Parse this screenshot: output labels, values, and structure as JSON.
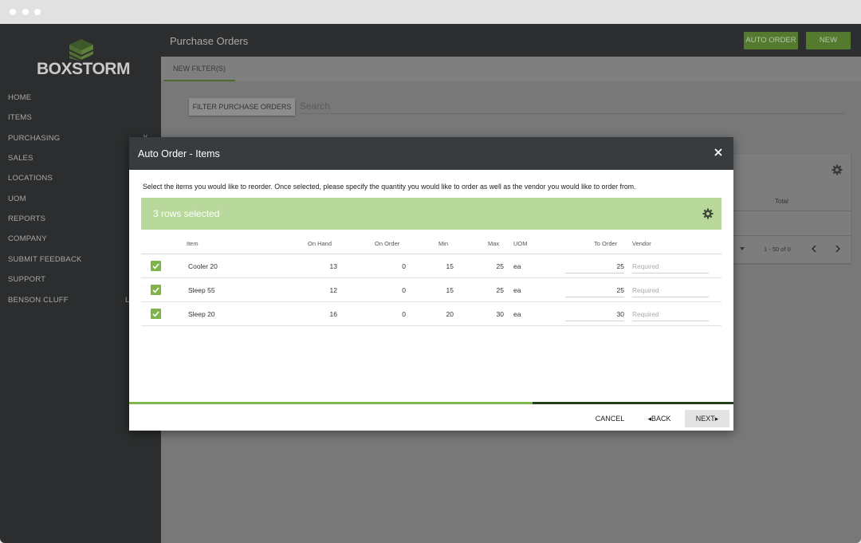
{
  "sidebar": {
    "brand": "BOXSTORM",
    "items": [
      {
        "label": "HOME"
      },
      {
        "label": "ITEMS"
      },
      {
        "label": "PURCHASING"
      },
      {
        "label": "SALES"
      },
      {
        "label": "LOCATIONS"
      },
      {
        "label": "UOM"
      },
      {
        "label": "REPORTS"
      },
      {
        "label": "COMPANY"
      },
      {
        "label": "SUBMIT FEEDBACK"
      },
      {
        "label": "SUPPORT"
      },
      {
        "label": "BENSON CLUFF"
      }
    ],
    "purchasing_marker": "v",
    "user_marker": "L"
  },
  "header": {
    "title": "Purchase Orders",
    "auto_order_label": "AUTO ORDER",
    "new_label": "NEW"
  },
  "tabs": {
    "active": "NEW FILTER(S)"
  },
  "filter": {
    "button_label": "FILTER PURCHASE ORDERS",
    "search_placeholder": "Search"
  },
  "background_card": {
    "total_header": "Total",
    "paging": "1 - 50 of 0"
  },
  "modal": {
    "title": "Auto Order - Items",
    "instructions": "Select the items you would like to reorder. Once selected, please specify the quantity you would like to order as well as the vendor you would like to order from.",
    "selection_text": "3 rows selected",
    "columns": {
      "item": "Item",
      "on_hand": "On Hand",
      "on_order": "On Order",
      "min": "Min",
      "max": "Max",
      "uom": "UOM",
      "to_order": "To Order",
      "vendor": "Vendor"
    },
    "rows": [
      {
        "item": "Cooler 20",
        "on_hand": "13",
        "on_order": "0",
        "min": "15",
        "max": "25",
        "uom": "ea",
        "to_order": "25",
        "vendor_placeholder": "Required",
        "checked": true
      },
      {
        "item": "Sleep 55",
        "on_hand": "12",
        "on_order": "0",
        "min": "15",
        "max": "25",
        "uom": "ea",
        "to_order": "25",
        "vendor_placeholder": "Required",
        "checked": true
      },
      {
        "item": "Sleep 20",
        "on_hand": "16",
        "on_order": "0",
        "min": "20",
        "max": "30",
        "uom": "ea",
        "to_order": "30",
        "vendor_placeholder": "Required",
        "checked": true
      }
    ],
    "progress": 0.667,
    "cancel_label": "CANCEL",
    "back_label": "BACK",
    "next_label": "NEXT"
  },
  "colors": {
    "accent": "#7eb74b",
    "selection_bar": "#b8d99b",
    "header_dark": "#383c3e"
  }
}
